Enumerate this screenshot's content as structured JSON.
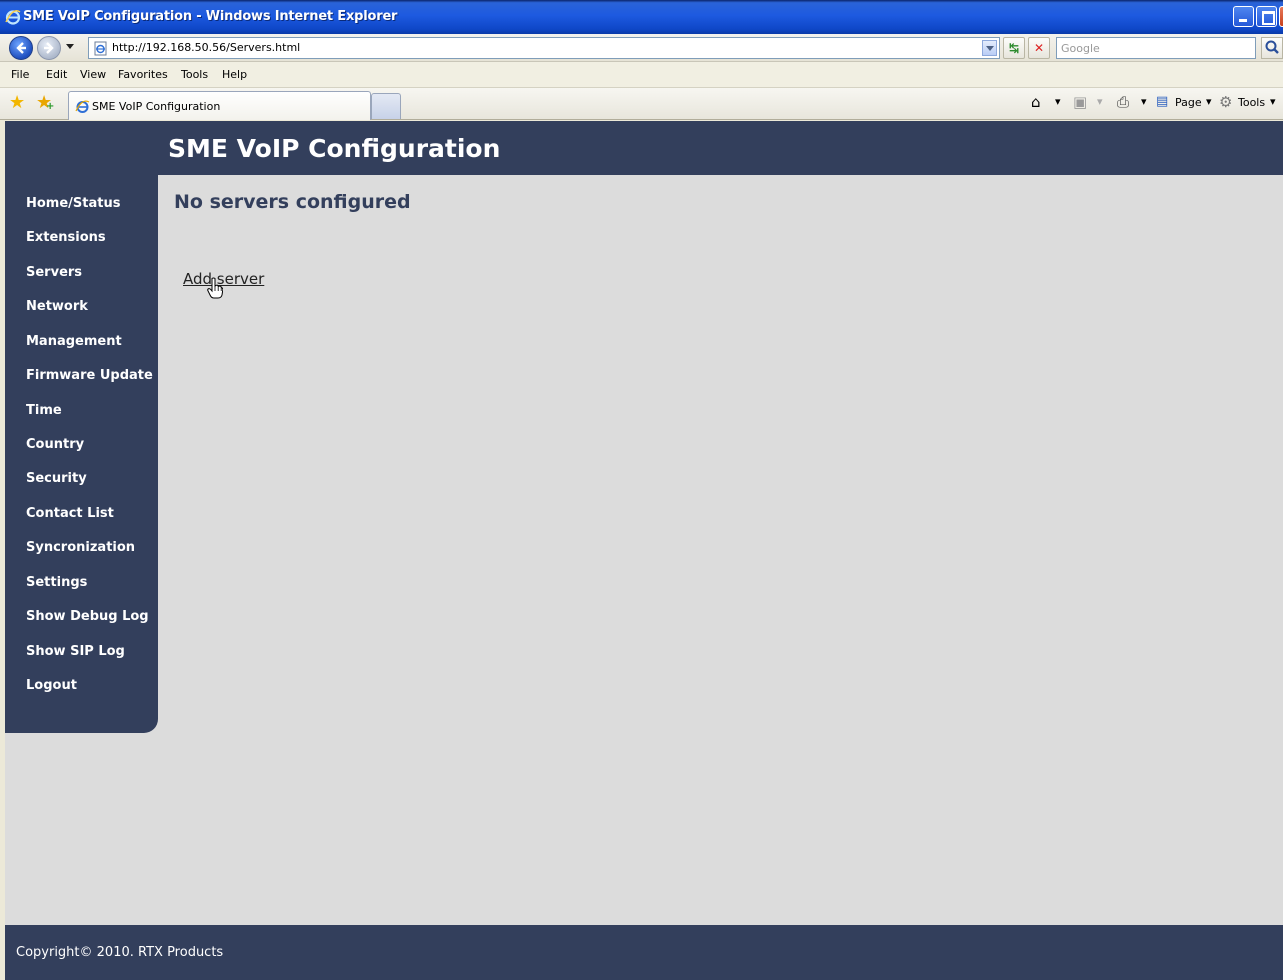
{
  "window": {
    "title": "SME VoIP Configuration - Windows Internet Explorer"
  },
  "address_bar": {
    "url": "http://192.168.50.56/Servers.html",
    "search_placeholder": "Google"
  },
  "menu": {
    "items": [
      "File",
      "Edit",
      "View",
      "Favorites",
      "Tools",
      "Help"
    ]
  },
  "tabs": {
    "active_label": "SME VoIP Configuration"
  },
  "command_bar": {
    "page_label": "Page",
    "tools_label": "Tools"
  },
  "page": {
    "app_title": "SME VoIP Configuration",
    "heading": "No servers configured",
    "add_server_link": "Add server",
    "footer": "Copyright© 2010. RTX Products",
    "nav": [
      "Home/Status",
      "Extensions",
      "Servers",
      "Network",
      "Management",
      "Firmware Update",
      "Time",
      "Country",
      "Security",
      "Contact List",
      "Syncronization",
      "Settings",
      "Show Debug Log",
      "Show SIP Log",
      "Logout"
    ]
  },
  "colors": {
    "header_navy": "#333f5c",
    "content_gray": "#dcdcdc",
    "titlebar_blue": "#1d5ae0"
  }
}
